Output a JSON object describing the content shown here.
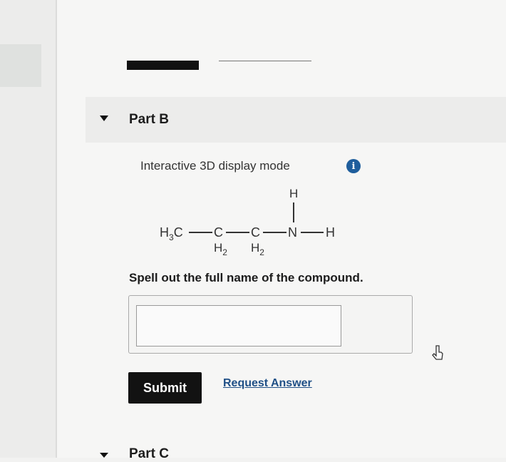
{
  "part": {
    "title": "Part B",
    "display_mode_label": "Interactive 3D display mode",
    "info_icon": "info-icon"
  },
  "molecule": {
    "h3c": "H",
    "h3c_sub": "3",
    "h3c_c": "C",
    "c2": "C",
    "c2_h": "H",
    "c2_h_sub": "2",
    "c3": "C",
    "c3_h": "H",
    "c3_h_sub": "2",
    "n": "N",
    "n_h_top": "H",
    "n_h_right": "H"
  },
  "question": "Spell out the full name of the compound.",
  "answer": {
    "value": ""
  },
  "buttons": {
    "submit": "Submit",
    "request_answer": "Request Answer"
  },
  "next_part": {
    "title": "Part C"
  }
}
